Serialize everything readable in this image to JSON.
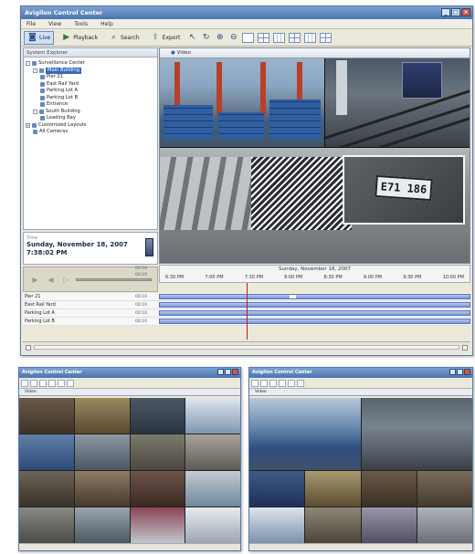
{
  "main_window": {
    "title": "Avigilon Control Center",
    "menu": [
      "File",
      "View",
      "Tools",
      "Help"
    ],
    "toolbar": {
      "live_label": "Live",
      "playback_label": "Playback",
      "search_label": "Search",
      "export_label": "Export"
    },
    "tree_header": "System Explorer",
    "tree": [
      {
        "label": "Surveillance Center",
        "level": 0,
        "expander": "-"
      },
      {
        "label": "Main Building",
        "level": 1,
        "expander": "-",
        "selected": true
      },
      {
        "label": "Pier 21",
        "level": 2
      },
      {
        "label": "East Rail Yard",
        "level": 2
      },
      {
        "label": "Parking Lot A",
        "level": 2
      },
      {
        "label": "Parking Lot B",
        "level": 2
      },
      {
        "label": "Entrance",
        "level": 2
      },
      {
        "label": "South Building",
        "level": 1,
        "expander": "-"
      },
      {
        "label": "Loading Bay",
        "level": 2
      },
      {
        "label": "Customized Layouts",
        "level": 0,
        "expander": "+"
      },
      {
        "label": "All Cameras",
        "level": 1
      }
    ],
    "date_panel": {
      "caption": "Time",
      "date": "Sunday, November 18, 2007",
      "time": "7:38:02 PM"
    },
    "video_tab": "Video",
    "plate_text": "E71 186",
    "timeline": {
      "date": "Sunday, November 18, 2007",
      "times": [
        "6:30 PM",
        "7:00 PM",
        "7:30 PM",
        "8:00 PM",
        "8:30 PM",
        "9:00 PM",
        "9:30 PM",
        "10:00 PM"
      ],
      "zoom_marks": [
        "00:10",
        "00:10"
      ],
      "rows": [
        {
          "label": "Pier 21",
          "zoom": "00:10",
          "gap": [
            0.42,
            0.44
          ]
        },
        {
          "label": "East Rail Yard",
          "zoom": "00:10"
        },
        {
          "label": "Parking Lot A",
          "zoom": "00:10"
        },
        {
          "label": "Parking Lot B",
          "zoom": "00:10"
        }
      ]
    }
  },
  "left_window": {
    "title": "Avigilon Control Center",
    "tab": "Video"
  },
  "right_window": {
    "title": "Avigilon Control Center",
    "tab": "Video"
  }
}
